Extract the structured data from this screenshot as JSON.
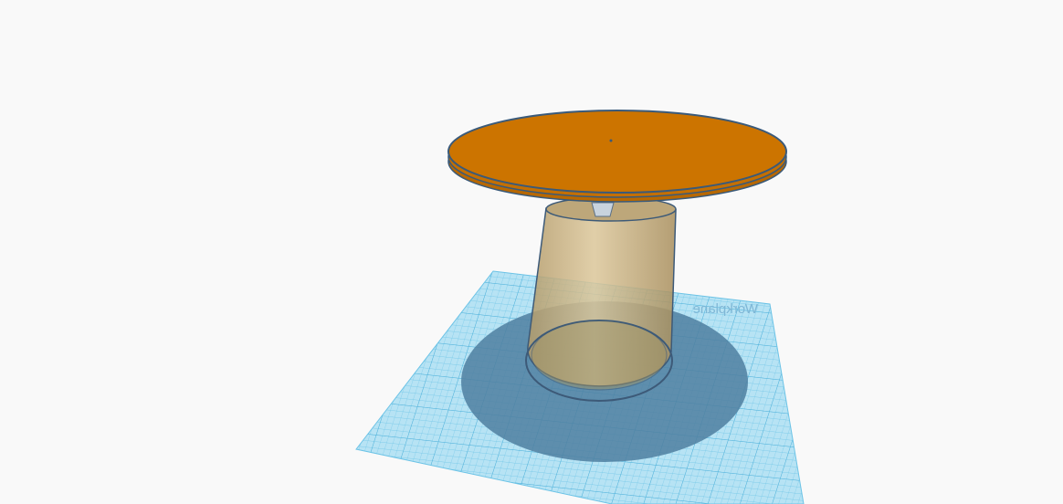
{
  "scene": {
    "workplane_label": "Workplane",
    "colors": {
      "background": "#f9f9f9",
      "grid_fill": "#a8dcf0",
      "grid_line": "#6cc3e6",
      "shadow": "#4f7fa0",
      "disc": "#cc7400",
      "disc_edge": "#3a5a7a",
      "cup": "#c9a868",
      "outline": "#3d5a78"
    }
  }
}
